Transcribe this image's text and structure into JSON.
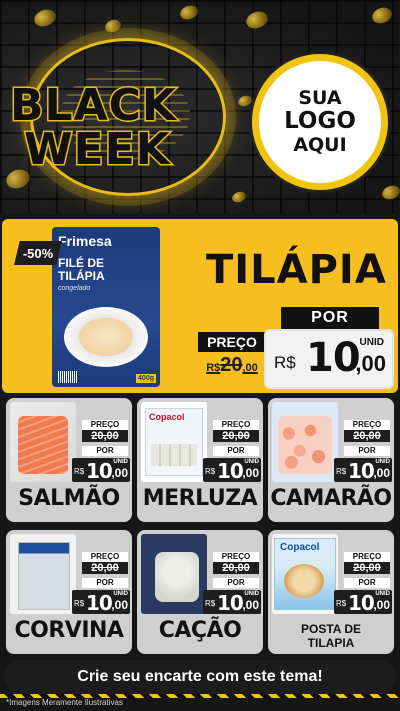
{
  "header": {
    "title_line1": "BLACK",
    "title_line2": "WEEK",
    "logo_line1": "SUA",
    "logo_line2": "LOGO",
    "logo_line3": "AQUI"
  },
  "featured": {
    "discount": "-50%",
    "brand": "Frimesa",
    "package_name": "FILÉ DE TILÁPIA",
    "package_sub": "congelado",
    "package_weight": "400g",
    "title": "TILÁPIA",
    "preco_label": "PREÇO",
    "old_price_prefix": "R$",
    "old_price_int": "20",
    "old_price_dec": ",00",
    "por_label": "POR",
    "currency": "R$",
    "price_int": "10",
    "price_dec": ",00",
    "unit": "UNID"
  },
  "products": [
    {
      "name": "SALMÃO",
      "preco_label": "PREÇO",
      "old_price": "20,00",
      "por_label": "POR",
      "currency": "R$",
      "price_int": "10",
      "price_dec": ",00",
      "unit": "UNID"
    },
    {
      "name": "MERLUZA",
      "brand": "Copacol",
      "preco_label": "PREÇO",
      "old_price": "20,00",
      "por_label": "POR",
      "currency": "R$",
      "price_int": "10",
      "price_dec": ",00",
      "unit": "UNID"
    },
    {
      "name": "CAMARÃO",
      "preco_label": "PREÇO",
      "old_price": "20,00",
      "por_label": "POR",
      "currency": "R$",
      "price_int": "10",
      "price_dec": ",00",
      "unit": "UNID"
    },
    {
      "name": "CORVINA",
      "preco_label": "PREÇO",
      "old_price": "20,00",
      "por_label": "POR",
      "currency": "R$",
      "price_int": "10",
      "price_dec": ",00",
      "unit": "UNID"
    },
    {
      "name": "CAÇÃO",
      "preco_label": "PREÇO",
      "old_price": "20,00",
      "por_label": "POR",
      "currency": "R$",
      "price_int": "10",
      "price_dec": ",00",
      "unit": "UNID"
    },
    {
      "name_line1": "POSTA DE",
      "name_line2": "TILAPIA",
      "brand": "Copacol",
      "preco_label": "PREÇO",
      "old_price": "20,00",
      "por_label": "POR",
      "currency": "R$",
      "price_int": "10",
      "price_dec": ",00",
      "unit": "UNID"
    }
  ],
  "footer": {
    "cta": "Crie seu encarte com este tema!",
    "disclaimer": "*Imagens Meramente Ilustrativas"
  },
  "colors": {
    "accent": "#f6be1e",
    "dark": "#1e1e1e",
    "tile": "#cfcfcf"
  }
}
